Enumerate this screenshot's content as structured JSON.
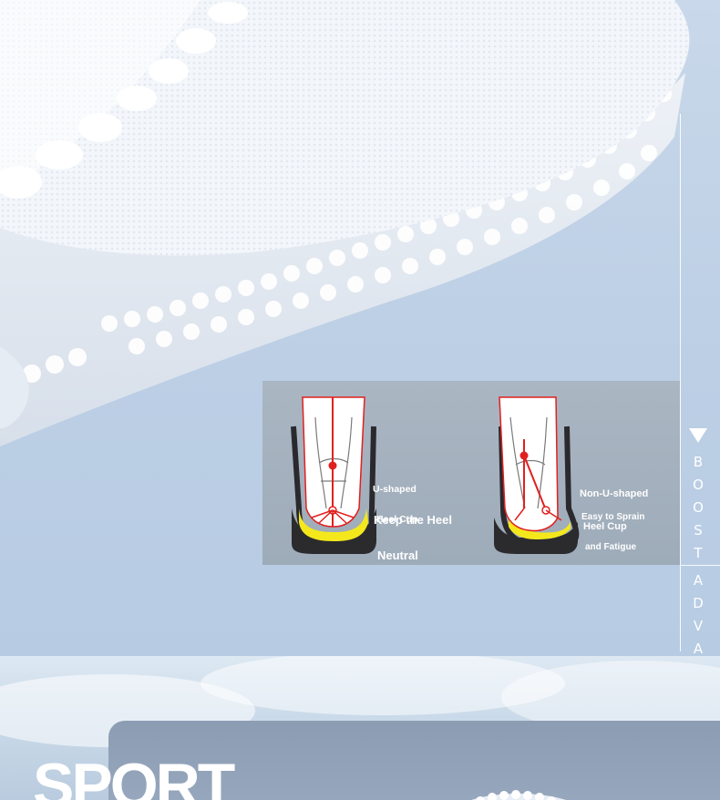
{
  "side_label": {
    "top_letters": [
      "B",
      "O",
      "O",
      "S",
      "T"
    ],
    "bottom_letters": [
      "A",
      "D",
      "V",
      "A"
    ]
  },
  "heel_panel": {
    "left": {
      "title_line1": "U-shaped",
      "title_line2": "Heel Cup",
      "desc_line1": "Keep the Heel",
      "desc_line2": "Neutral"
    },
    "right": {
      "title_line1": "Non-U-shaped",
      "title_line2": "Heel Cup",
      "desc_line1": "Easy to Sprain",
      "desc_line2": "and Fatigue"
    }
  },
  "sport_heading": "SPORT",
  "colors": {
    "background": "#bccfe5",
    "panel": "#a4b1bf",
    "highlight_red": "#e0201f",
    "cushion_yellow": "#f4e81c",
    "heel_cup_dark": "#2b2b2e"
  }
}
